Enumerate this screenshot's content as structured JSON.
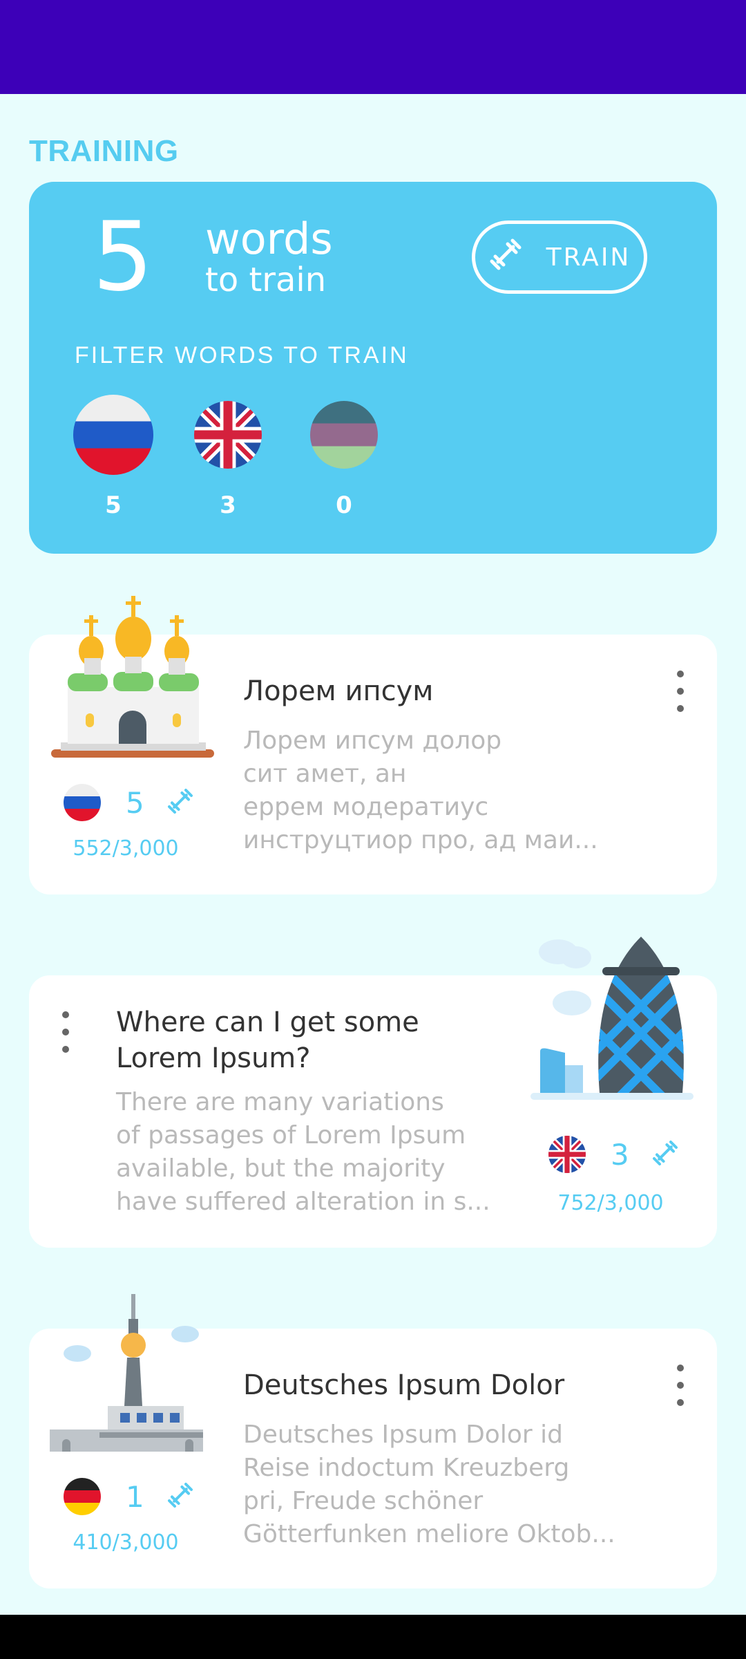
{
  "section": {
    "title": "TRAINING"
  },
  "training": {
    "count": "5",
    "words_label": "words",
    "to_train_label": "to train",
    "train_button": "TRAIN",
    "filter_label": "FILTER WORDS TO TRAIN",
    "filters": [
      {
        "flag": "russia-flag-icon",
        "count": "5"
      },
      {
        "flag": "uk-flag-icon",
        "count": "3"
      },
      {
        "flag": "mystery-flag-icon",
        "count": "0"
      }
    ]
  },
  "cards": [
    {
      "image": "church-illustration",
      "flag": "russia-flag-icon",
      "count": "5",
      "progress": "552/3,000",
      "title": "Лорем ипсум",
      "body": [
        "Лорем ипсум долор",
        "сит амет, ан",
        "еррем модератиус",
        "инструцтиор про, ад маи..."
      ]
    },
    {
      "image": "gherkin-building-illustration",
      "flag": "uk-flag-icon",
      "count": "3",
      "progress": "752/3,000",
      "title_lines": [
        "Where can I get some",
        "Lorem Ipsum?"
      ],
      "body": [
        "There are many variations",
        "of passages of Lorem Ipsum",
        "available, but the majority",
        "have suffered alteration in s..."
      ]
    },
    {
      "image": "tv-tower-illustration",
      "flag": "germany-flag-icon",
      "count": "1",
      "progress": "410/3,000",
      "title": "Deutsches Ipsum Dolor",
      "body": [
        "Deutsches Ipsum Dolor id",
        "Reise indoctum Kreuzberg",
        "pri, Freude schöner",
        "Götterfunken meliore Oktob..."
      ]
    }
  ],
  "colors": {
    "accent": "#56CCF2",
    "status_bar": "#3D00B8",
    "background": "#E8FDFD"
  }
}
